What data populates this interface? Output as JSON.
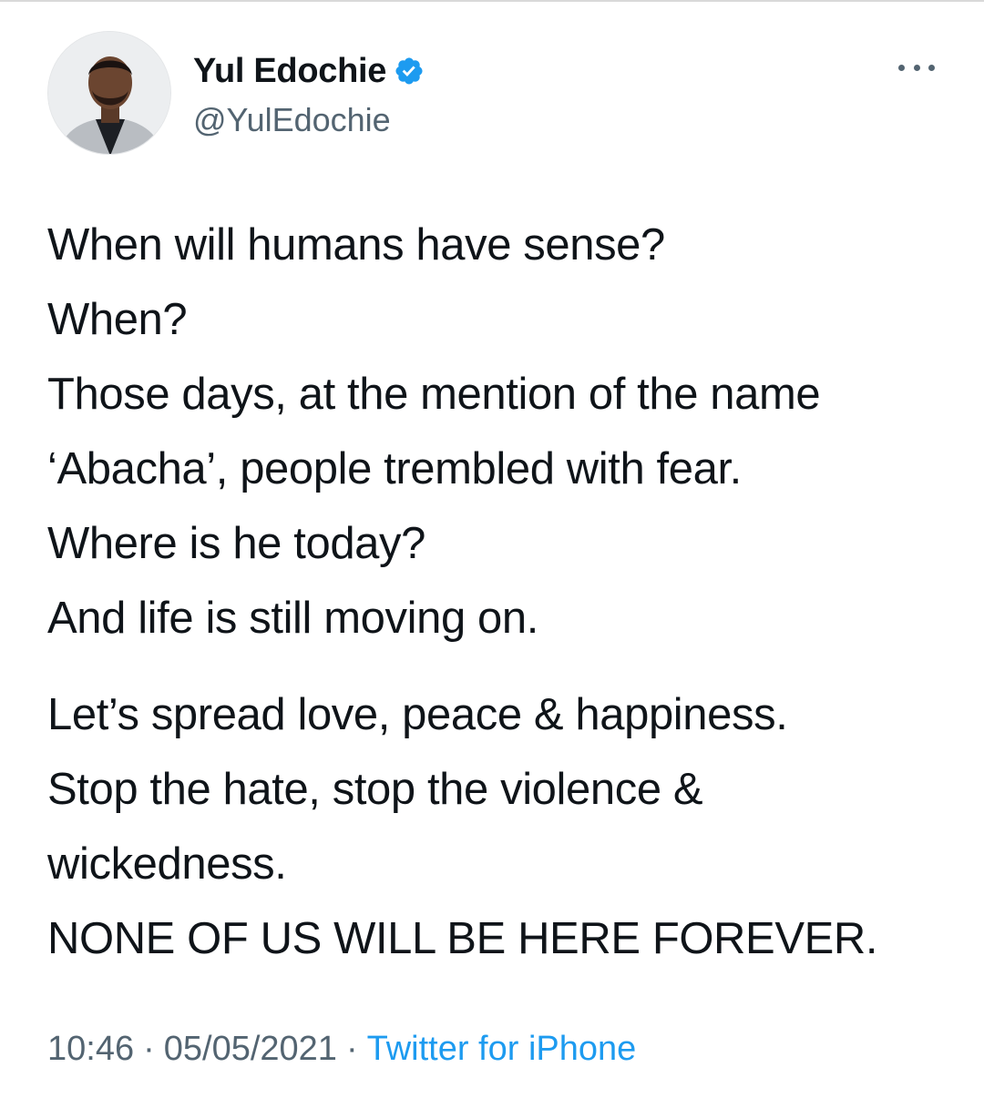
{
  "user": {
    "display_name": "Yul Edochie",
    "handle": "@YulEdochie",
    "verified": true
  },
  "tweet": {
    "paragraphs": [
      [
        "When will humans have sense?",
        "When?",
        "Those days, at the mention of the name",
        "‘Abacha’, people trembled with fear.",
        "Where is he today?",
        "And life is still moving on."
      ],
      [
        "Let’s spread love, peace & happiness.",
        "Stop the hate, stop the violence &",
        "wickedness.",
        "NONE OF US WILL BE HERE FOREVER."
      ]
    ]
  },
  "meta": {
    "time": "10:46",
    "separator": "·",
    "date": "05/05/2021",
    "source": "Twitter for iPhone"
  },
  "colors": {
    "text": "#0f1419",
    "secondary": "#536471",
    "accent": "#1d9bf0"
  },
  "icons": {
    "verified": "verified-badge-icon",
    "more": "more-options-icon"
  }
}
